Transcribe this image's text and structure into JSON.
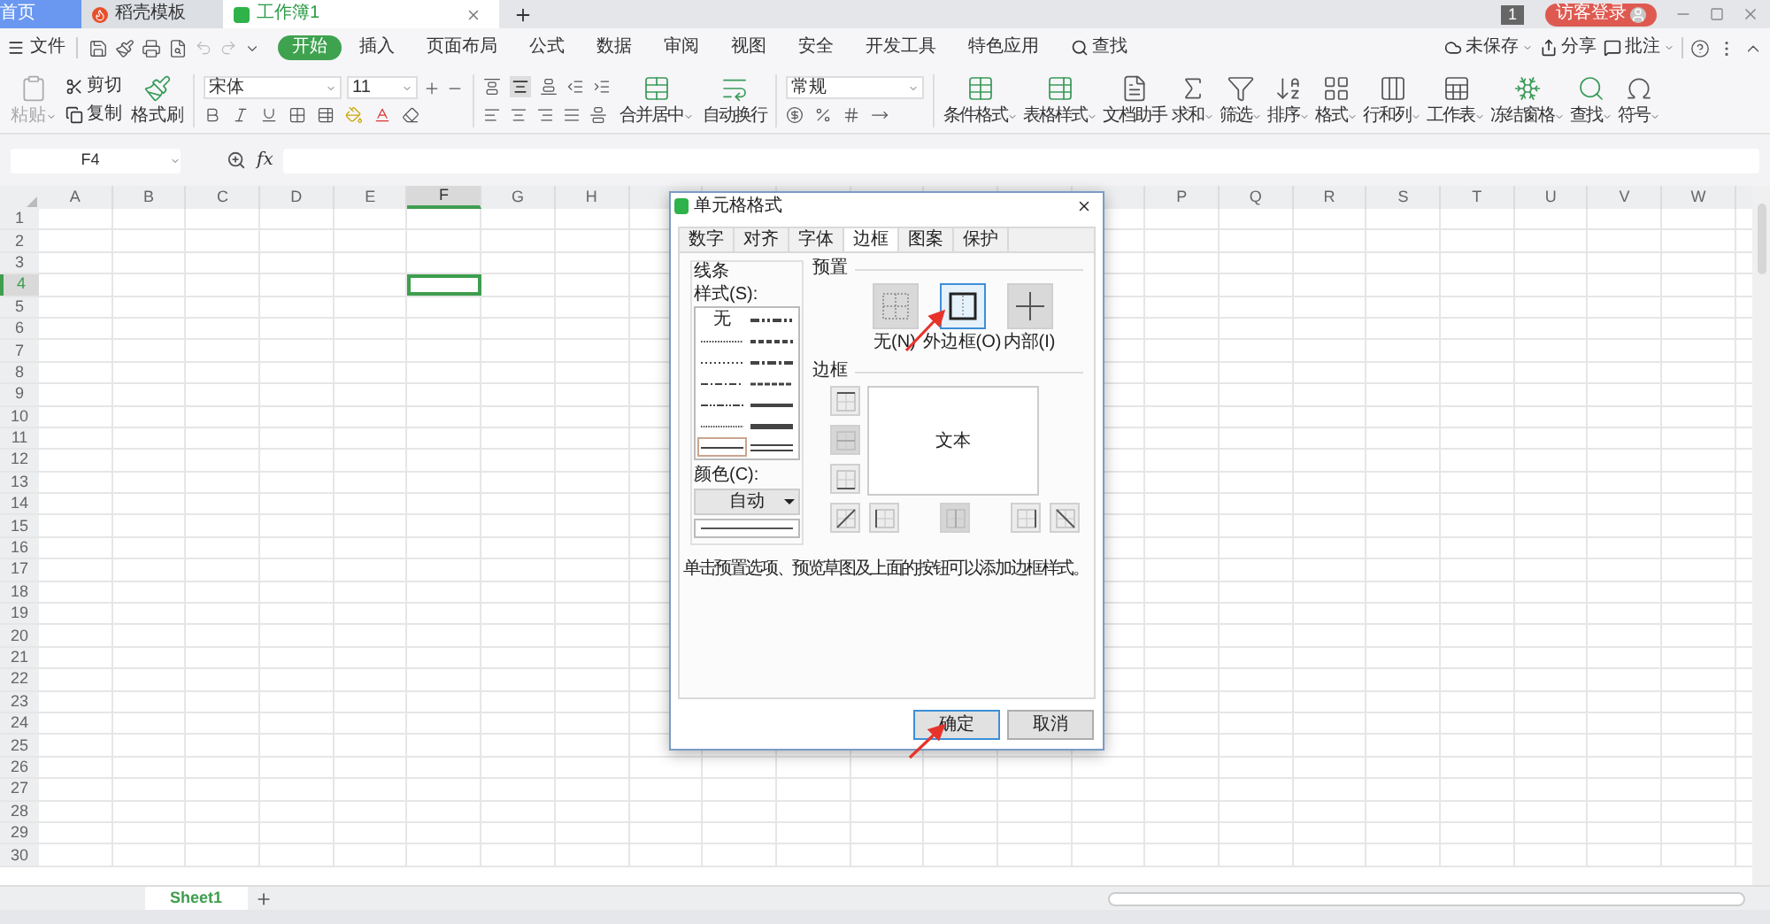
{
  "app_tabs": [
    {
      "label": "首页",
      "selected": false,
      "kind": "home"
    },
    {
      "label": "稻壳模板",
      "selected": false,
      "kind": "docer"
    },
    {
      "label": "工作簿1",
      "selected": true,
      "kind": "sheet"
    }
  ],
  "window_count": "1",
  "login_button": "访客登录",
  "menu": {
    "file": "文件",
    "tabs": [
      {
        "label": "开始",
        "selected": true
      },
      {
        "label": "插入",
        "selected": false
      },
      {
        "label": "页面布局",
        "selected": false
      },
      {
        "label": "公式",
        "selected": false
      },
      {
        "label": "数据",
        "selected": false
      },
      {
        "label": "审阅",
        "selected": false
      },
      {
        "label": "视图",
        "selected": false
      },
      {
        "label": "安全",
        "selected": false
      },
      {
        "label": "开发工具",
        "selected": false
      },
      {
        "label": "特色应用",
        "selected": false
      }
    ],
    "search": "查找",
    "unsaved": "未保存",
    "share": "分享",
    "comment": "批注"
  },
  "ribbon": {
    "paste": {
      "label": "粘贴",
      "disabled": true
    },
    "cut": "剪切",
    "copy": "复制",
    "format_painter": "格式刷",
    "font": "宋体",
    "font_size": "11",
    "merge": "合并居中",
    "wrap": "自动换行",
    "number_format": "常规",
    "tools": [
      {
        "label": "条件格式",
        "dropdown": true
      },
      {
        "label": "表格样式",
        "dropdown": true
      },
      {
        "label": "文档助手",
        "dropdown": false
      },
      {
        "label": "求和",
        "dropdown": true
      },
      {
        "label": "筛选",
        "dropdown": true
      },
      {
        "label": "排序",
        "dropdown": true
      },
      {
        "label": "格式",
        "dropdown": true
      },
      {
        "label": "行和列",
        "dropdown": true
      },
      {
        "label": "工作表",
        "dropdown": true
      },
      {
        "label": "冻结窗格",
        "dropdown": true
      },
      {
        "label": "查找",
        "dropdown": true
      },
      {
        "label": "符号",
        "dropdown": true
      }
    ]
  },
  "formula_bar": {
    "name_box": "F4",
    "fx": "fx"
  },
  "columns_left": [
    {
      "label": "A",
      "selected": false
    },
    {
      "label": "B",
      "selected": false
    },
    {
      "label": "C",
      "selected": false
    },
    {
      "label": "D",
      "selected": false
    },
    {
      "label": "E",
      "selected": false
    },
    {
      "label": "F",
      "selected": true
    },
    {
      "label": "G",
      "selected": false
    },
    {
      "label": "H",
      "selected": false
    }
  ],
  "columns_right": [
    {
      "label": "P",
      "selected": false
    },
    {
      "label": "Q",
      "selected": false
    },
    {
      "label": "R",
      "selected": false
    },
    {
      "label": "S",
      "selected": false
    },
    {
      "label": "T",
      "selected": false
    },
    {
      "label": "U",
      "selected": false
    },
    {
      "label": "V",
      "selected": false
    },
    {
      "label": "W",
      "selected": false
    }
  ],
  "rows": [
    {
      "label": "1",
      "selected": false
    },
    {
      "label": "2",
      "selected": false
    },
    {
      "label": "3",
      "selected": false
    },
    {
      "label": "4",
      "selected": true
    },
    {
      "label": "5",
      "selected": false
    },
    {
      "label": "6",
      "selected": false
    },
    {
      "label": "7",
      "selected": false
    },
    {
      "label": "8",
      "selected": false
    },
    {
      "label": "9",
      "selected": false
    },
    {
      "label": "10",
      "selected": false
    },
    {
      "label": "11",
      "selected": false
    },
    {
      "label": "12",
      "selected": false
    },
    {
      "label": "13",
      "selected": false
    },
    {
      "label": "14",
      "selected": false
    },
    {
      "label": "15",
      "selected": false
    },
    {
      "label": "16",
      "selected": false
    },
    {
      "label": "17",
      "selected": false
    },
    {
      "label": "18",
      "selected": false
    },
    {
      "label": "19",
      "selected": false
    },
    {
      "label": "20",
      "selected": false
    },
    {
      "label": "21",
      "selected": false
    },
    {
      "label": "22",
      "selected": false
    },
    {
      "label": "23",
      "selected": false
    },
    {
      "label": "24",
      "selected": false
    },
    {
      "label": "25",
      "selected": false
    },
    {
      "label": "26",
      "selected": false
    },
    {
      "label": "27",
      "selected": false
    },
    {
      "label": "28",
      "selected": false
    },
    {
      "label": "29",
      "selected": false
    },
    {
      "label": "30",
      "selected": false
    }
  ],
  "sheet_tabs": [
    {
      "label": "Sheet1",
      "selected": true
    }
  ],
  "dialog": {
    "title": "单元格格式",
    "tabs": [
      {
        "label": "数字",
        "selected": false
      },
      {
        "label": "对齐",
        "selected": false
      },
      {
        "label": "字体",
        "selected": false
      },
      {
        "label": "边框",
        "selected": true
      },
      {
        "label": "图案",
        "selected": false
      },
      {
        "label": "保护",
        "selected": false
      }
    ],
    "line_group": "线条",
    "style_label": "样式(S):",
    "line_styles": [
      {
        "kind": "none",
        "label": "无",
        "selected": false
      },
      {
        "kind": "hair",
        "selected": false
      },
      {
        "kind": "dotted",
        "selected": false
      },
      {
        "kind": "dashdot",
        "selected": false
      },
      {
        "kind": "dashdotdot",
        "selected": false
      },
      {
        "kind": "finedot",
        "selected": false
      },
      {
        "kind": "thin",
        "selected": true
      },
      {
        "kind": "medium_dashdotdot",
        "selected": false
      },
      {
        "kind": "medium_dashed",
        "selected": false
      },
      {
        "kind": "medium_dashdot",
        "selected": false
      },
      {
        "kind": "dashed",
        "selected": false
      },
      {
        "kind": "medium",
        "selected": false
      },
      {
        "kind": "thick",
        "selected": false
      },
      {
        "kind": "double",
        "selected": false
      }
    ],
    "color_label": "颜色(C):",
    "color_value": "自动",
    "preset_group": "预置",
    "presets": [
      {
        "label": "无(N)",
        "kind": "none",
        "selected": false
      },
      {
        "label": "外边框(O)",
        "kind": "outline",
        "selected": true
      },
      {
        "label": "内部(I)",
        "kind": "inside",
        "selected": false
      }
    ],
    "border_group": "边框",
    "preview_text": "文本",
    "border_buttons": [
      {
        "kind": "top",
        "disabled": false
      },
      {
        "kind": "middle_h",
        "disabled": true
      },
      {
        "kind": "bottom",
        "disabled": false
      },
      {
        "kind": "diag_up",
        "disabled": false
      },
      {
        "kind": "left",
        "disabled": false
      },
      {
        "kind": "middle_v",
        "disabled": true
      },
      {
        "kind": "right",
        "disabled": false
      },
      {
        "kind": "diag_down",
        "disabled": false
      }
    ],
    "hint": "单击预置选项、预览草图及上面的按钮可以添加边框样式。",
    "buttons": [
      {
        "label": "确定",
        "primary": true
      },
      {
        "label": "取消",
        "primary": false
      }
    ]
  }
}
